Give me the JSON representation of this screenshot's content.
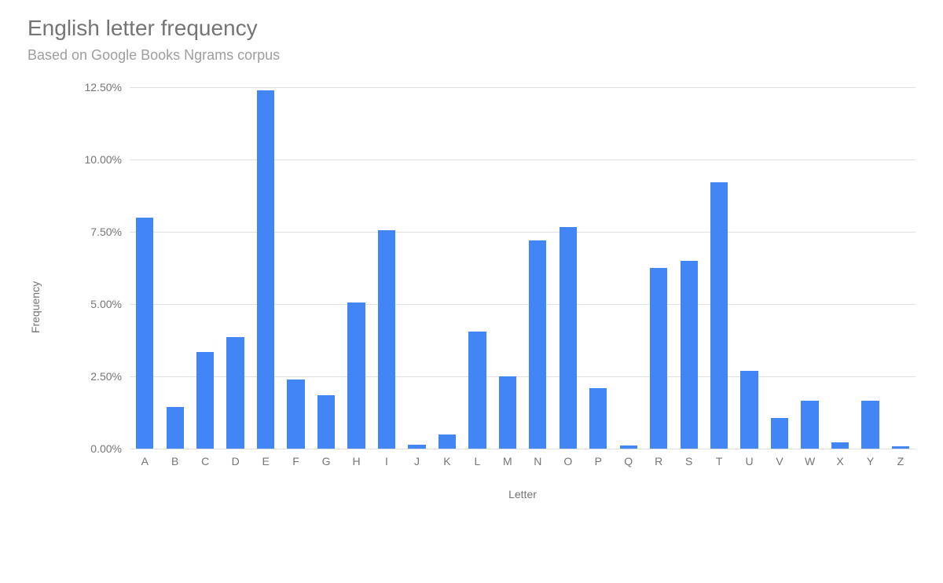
{
  "chart_data": {
    "type": "bar",
    "title": "English letter frequency",
    "subtitle": "Based on Google Books Ngrams corpus",
    "xlabel": "Letter",
    "ylabel": "Frequency",
    "ylim": [
      0,
      12.5
    ],
    "yticks": [
      0,
      2.5,
      5,
      7.5,
      10,
      12.5
    ],
    "ytick_labels": [
      "0.00%",
      "2.50%",
      "5.00%",
      "7.50%",
      "10.00%",
      "12.50%"
    ],
    "categories": [
      "A",
      "B",
      "C",
      "D",
      "E",
      "F",
      "G",
      "H",
      "I",
      "J",
      "K",
      "L",
      "M",
      "N",
      "O",
      "P",
      "Q",
      "R",
      "S",
      "T",
      "U",
      "V",
      "W",
      "X",
      "Y",
      "Z"
    ],
    "values": [
      8.0,
      1.45,
      3.35,
      3.85,
      12.4,
      2.4,
      1.85,
      5.05,
      7.55,
      0.13,
      0.5,
      4.05,
      2.5,
      7.2,
      7.65,
      2.1,
      0.1,
      6.25,
      6.5,
      9.2,
      2.7,
      1.05,
      1.65,
      0.23,
      1.65,
      0.08
    ],
    "bar_color": "#4285f4"
  }
}
